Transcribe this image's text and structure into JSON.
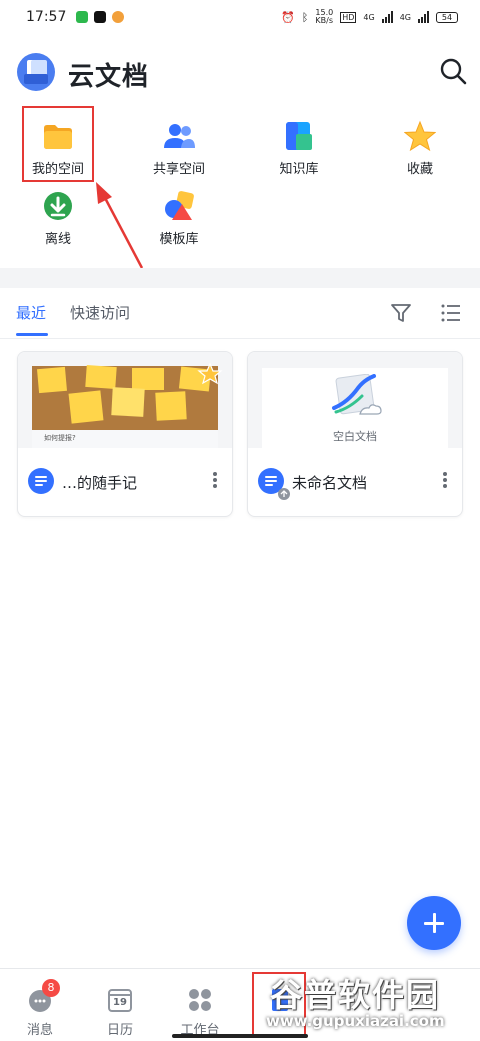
{
  "status_bar": {
    "time": "17:57",
    "network_speed": "15.0\nKB/s",
    "hd_label": "HD",
    "sim1_label": "4G",
    "sim2_label": "4G",
    "battery": "54"
  },
  "header": {
    "title": "云文档"
  },
  "shortcuts": [
    {
      "label": "我的空间",
      "icon": "folder-icon"
    },
    {
      "label": "共享空间",
      "icon": "people-icon"
    },
    {
      "label": "知识库",
      "icon": "knowledge-base-icon"
    },
    {
      "label": "收藏",
      "icon": "star-icon"
    },
    {
      "label": "离线",
      "icon": "download-icon"
    },
    {
      "label": "模板库",
      "icon": "template-icon"
    }
  ],
  "tabs": {
    "active": "最近",
    "second": "快速访问"
  },
  "documents": [
    {
      "name": "…的随手记",
      "thumbnail_caption": "如何提报?"
    },
    {
      "name": "未命名文档",
      "thumbnail_caption": "空白文档"
    }
  ],
  "bottom_nav": [
    {
      "label": "消息",
      "icon": "message-icon",
      "badge": "8"
    },
    {
      "label": "日历",
      "icon": "calendar-icon",
      "date": "19"
    },
    {
      "label": "工作台",
      "icon": "workspace-icon"
    },
    {
      "label": "",
      "icon": "docs-icon"
    }
  ],
  "watermark": {
    "title": "谷普软件园",
    "url": "www.gupuxiazai.com"
  },
  "colors": {
    "accent": "#3370ff",
    "annotation": "#e53935"
  }
}
